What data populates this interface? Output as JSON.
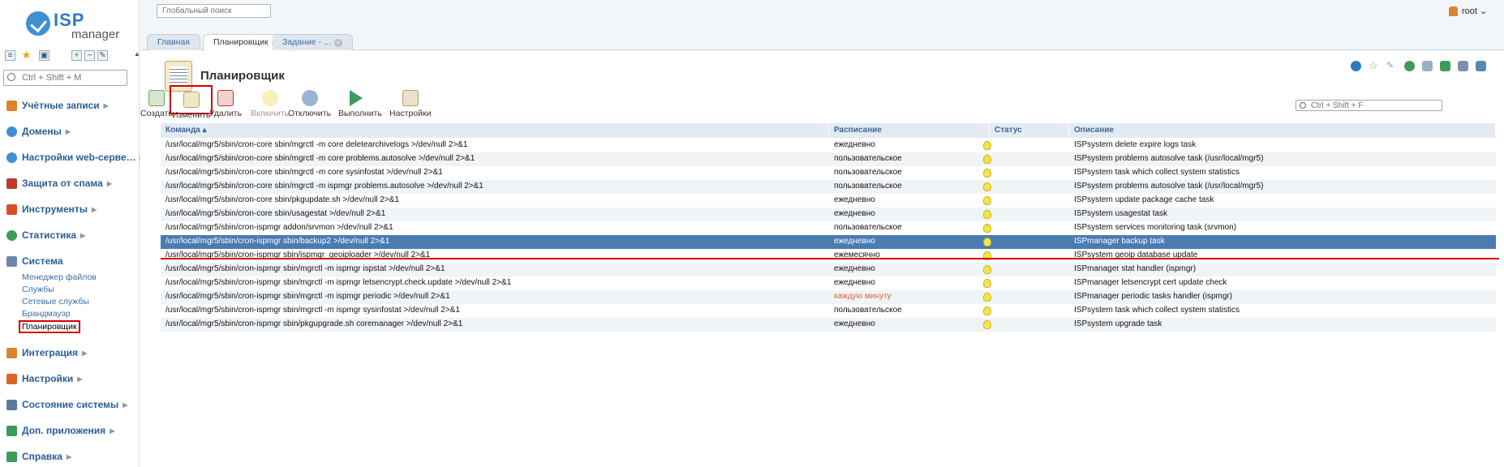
{
  "app": {
    "logo_isp": "ISP",
    "logo_manager": "manager"
  },
  "top": {
    "search_placeholder": "Глобальный поиск",
    "user": "root ⌄"
  },
  "sidebar": {
    "search_placeholder": "Ctrl + Shift + M",
    "groups": [
      {
        "label": "Учётные записи",
        "color": "#d9852e"
      },
      {
        "label": "Домены",
        "color": "#3f8fd2"
      },
      {
        "label": "Настройки web-серве…",
        "color": "#3f8fd2"
      },
      {
        "label": "Защита от спама",
        "color": "#c0392b"
      },
      {
        "label": "Инструменты",
        "color": "#d94f2b"
      },
      {
        "label": "Статистика",
        "color": "#3c9c5a"
      },
      {
        "label": "Система",
        "color": "#6b88a8"
      },
      {
        "label": "Интеграция",
        "color": "#d9852e"
      },
      {
        "label": "Настройки",
        "color": "#d9642c"
      },
      {
        "label": "Состояние системы",
        "color": "#5a7a9a"
      },
      {
        "label": "Доп. приложения",
        "color": "#3c9c5a"
      },
      {
        "label": "Справка",
        "color": "#3c9c5a"
      }
    ],
    "system_items": [
      "Менеджер файлов",
      "Службы",
      "Сетевые службы",
      "Брандмауэр",
      "Планировщик"
    ]
  },
  "tabs": [
    {
      "label": "Главная"
    },
    {
      "label": "Планировщик",
      "close": "×"
    },
    {
      "label": "Задание - ...",
      "close": "×"
    }
  ],
  "page": {
    "title": "Планировщик",
    "filter_placeholder": "Ctrl + Shift + F"
  },
  "toolbar": {
    "create": "Создать",
    "edit": "Изменить",
    "delete": "Удалить",
    "enable": "Включить",
    "disable": "Отключить",
    "run": "Выполнить",
    "settings": "Настройки"
  },
  "table": {
    "headers": {
      "command": "Команда ▴",
      "schedule": "Расписание",
      "status": "Статус",
      "description": "Описание"
    },
    "rows": [
      {
        "command": "/usr/local/mgr5/sbin/cron-core sbin/mgrctl -m core deletearchivelogs >/dev/null 2>&1",
        "schedule": "ежедневно",
        "description": "ISPsystem delete expire logs task"
      },
      {
        "command": "/usr/local/mgr5/sbin/cron-core sbin/mgrctl -m core problems.autosolve >/dev/null 2>&1",
        "schedule": "пользовательское",
        "description": "ISPsystem problems autosolve task (/usr/local/mgr5)"
      },
      {
        "command": "/usr/local/mgr5/sbin/cron-core sbin/mgrctl -m core sysinfostat >/dev/null 2>&1",
        "schedule": "пользовательское",
        "description": "ISPsystem task which collect system statistics"
      },
      {
        "command": "/usr/local/mgr5/sbin/cron-core sbin/mgrctl -m ispmgr problems.autosolve >/dev/null 2>&1",
        "schedule": "пользовательское",
        "description": "ISPsystem problems autosolve task (/usr/local/mgr5)"
      },
      {
        "command": "/usr/local/mgr5/sbin/cron-core sbin/pkgupdate.sh >/dev/null 2>&1",
        "schedule": "ежедневно",
        "description": "ISPsystem update package cache task"
      },
      {
        "command": "/usr/local/mgr5/sbin/cron-core sbin/usagestat >/dev/null 2>&1",
        "schedule": "ежедневно",
        "description": "ISPsystem usagestat task"
      },
      {
        "command": "/usr/local/mgr5/sbin/cron-ispmgr addon/srvmon >/dev/null 2>&1",
        "schedule": "пользовательское",
        "description": "ISPsystem services monitoring task (srvmon)"
      },
      {
        "command": "/usr/local/mgr5/sbin/cron-ispmgr sbin/backup2 >/dev/null 2>&1",
        "schedule": "ежедневно",
        "description": "ISPmanager backup task"
      },
      {
        "command": "/usr/local/mgr5/sbin/cron-ispmgr sbin/ispmgr_geoiploader >/dev/null 2>&1",
        "schedule": "ежемесячно",
        "description": "ISPsystem geoip database update"
      },
      {
        "command": "/usr/local/mgr5/sbin/cron-ispmgr sbin/mgrctl -m ispmgr ispstat >/dev/null 2>&1",
        "schedule": "ежедневно",
        "description": "ISPmanager stat handler (ispmgr)"
      },
      {
        "command": "/usr/local/mgr5/sbin/cron-ispmgr sbin/mgrctl -m ispmgr letsencrypt.check.update >/dev/null 2>&1",
        "schedule": "ежедневно",
        "description": "ISPmanager letsencrypt cert update check"
      },
      {
        "command": "/usr/local/mgr5/sbin/cron-ispmgr sbin/mgrctl -m ispmgr periodic >/dev/null 2>&1",
        "schedule": "каждую минуту",
        "description": "ISPmanager periodic tasks handler (ispmgr)"
      },
      {
        "command": "/usr/local/mgr5/sbin/cron-ispmgr sbin/mgrctl -m ispmgr sysinfostat >/dev/null 2>&1",
        "schedule": "пользовательское",
        "description": "ISPsystem task which collect system statistics"
      },
      {
        "command": "/usr/local/mgr5/sbin/cron-ispmgr sbin/pkgupgrade.sh coremanager >/dev/null 2>&1",
        "schedule": "ежедневно",
        "description": "ISPsystem upgrade task"
      }
    ],
    "selected_row": 7
  },
  "colors": {
    "accent": "#3b6ea5",
    "selected_row": "#4a7bb1",
    "highlight_box": "#d40000",
    "status_bulb": "#f3e34d"
  }
}
